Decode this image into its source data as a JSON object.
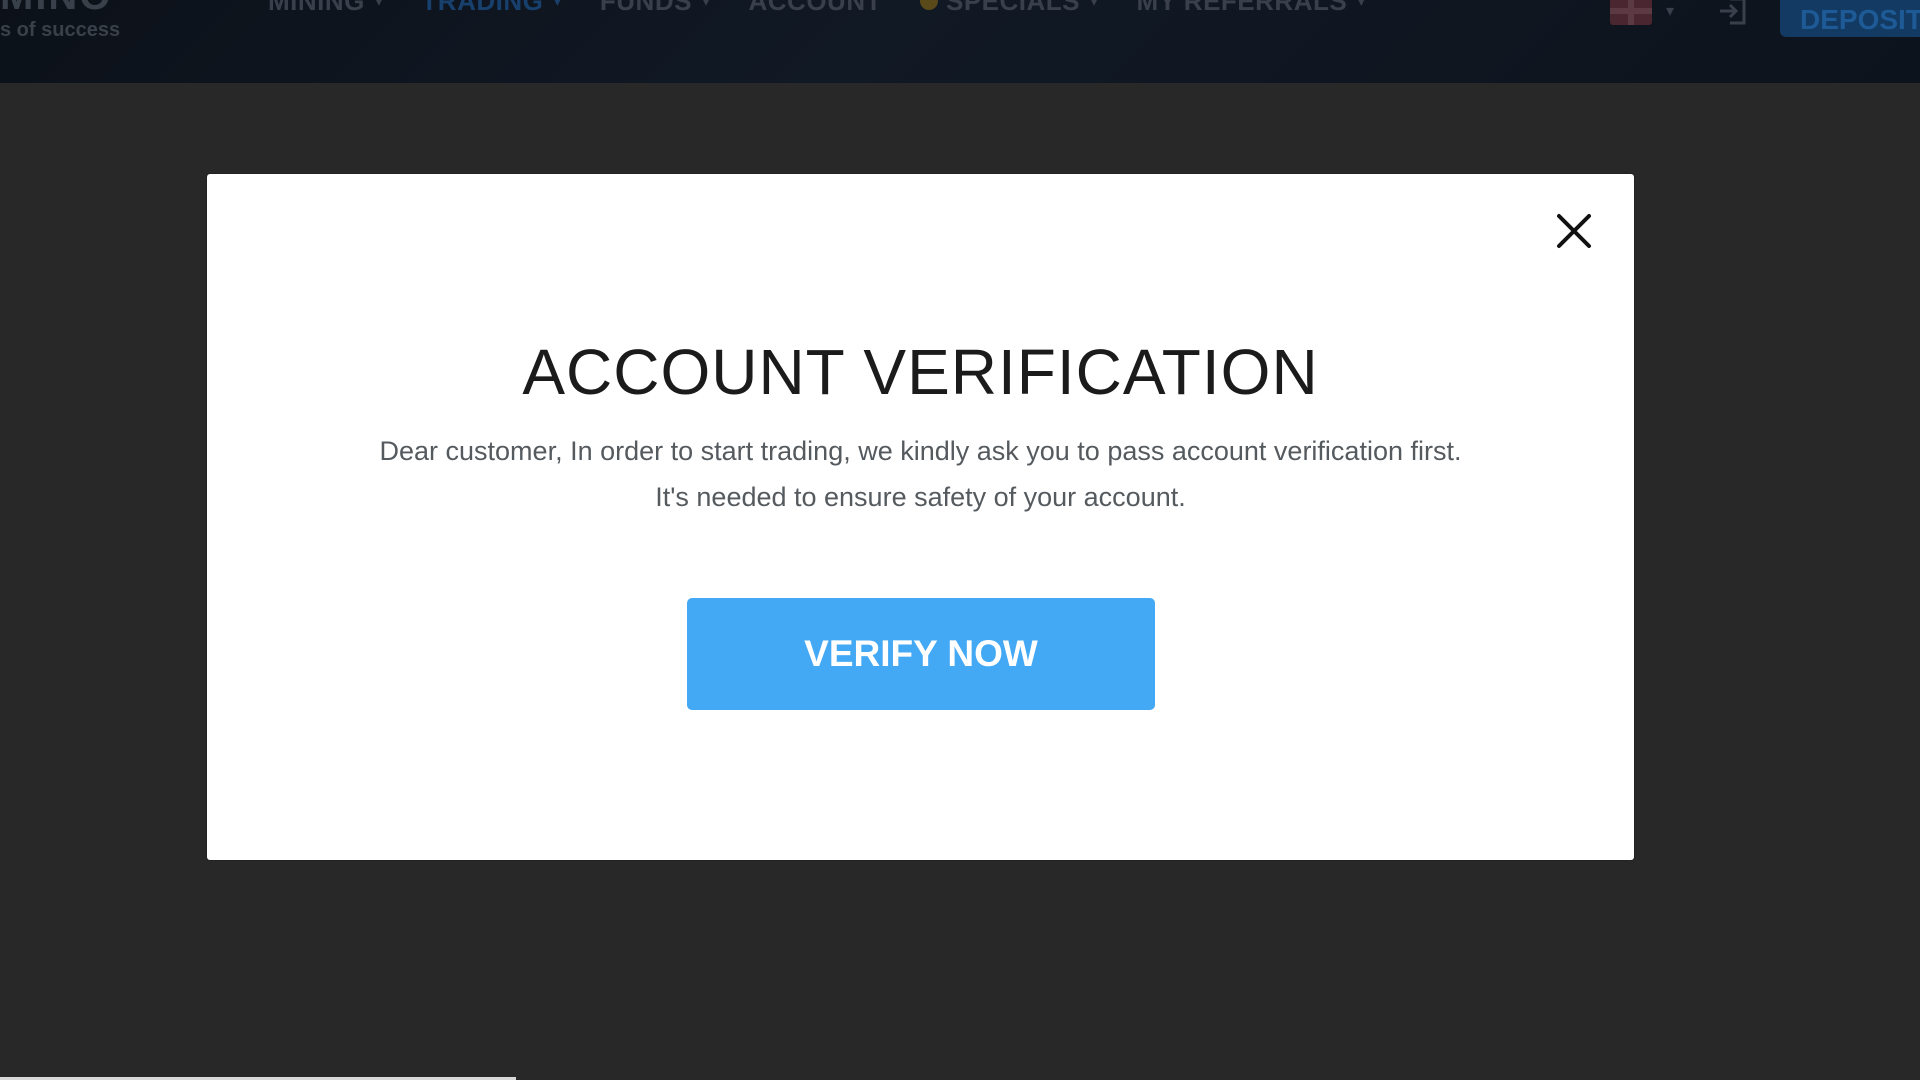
{
  "header": {
    "logo_text": "MINO",
    "tagline": "s of success",
    "nav": [
      {
        "label": "MINING",
        "has_dropdown": true,
        "active": false
      },
      {
        "label": "TRADING",
        "has_dropdown": true,
        "active": true
      },
      {
        "label": "FUNDS",
        "has_dropdown": true,
        "active": false
      },
      {
        "label": "ACCOUNT",
        "has_dropdown": false,
        "active": false
      },
      {
        "label": "SPECIALS",
        "has_dropdown": true,
        "active": false
      },
      {
        "label": "MY REFERRALS",
        "has_dropdown": true,
        "active": false
      }
    ],
    "language_icon": "uk-flag-icon",
    "logout_icon": "logout-icon",
    "deposit_label": "DEPOSIT"
  },
  "modal": {
    "title": "ACCOUNT VERIFICATION",
    "text": "Dear customer, In order to start trading, we kindly ask you to pass account verification first. It's needed to ensure safety of your account.",
    "button_label": "VERIFY NOW",
    "close_icon": "close-icon"
  },
  "colors": {
    "background": "#282828",
    "modal_background": "#ffffff",
    "button": "#44a9f5",
    "active_nav": "#18406c"
  }
}
